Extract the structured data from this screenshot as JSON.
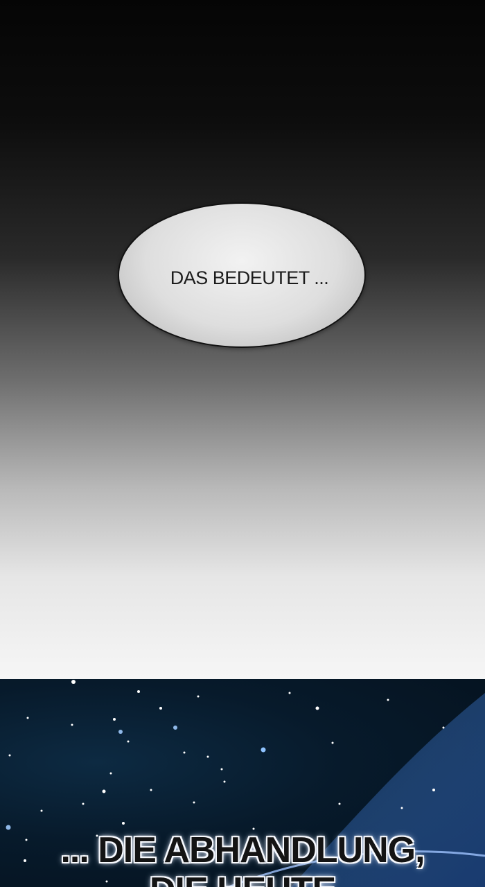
{
  "top_panel": {
    "speech_bubble_text": "DAS BEDEUTET ..."
  },
  "bottom_panel": {
    "caption_line_1": "... DIE ABHANDLUNG,",
    "caption_line_2": "DIE HEUTE"
  },
  "colors": {
    "night_sky": "#071a2b",
    "planet_glow": "#2f5fa3",
    "star": "#ffffff"
  }
}
